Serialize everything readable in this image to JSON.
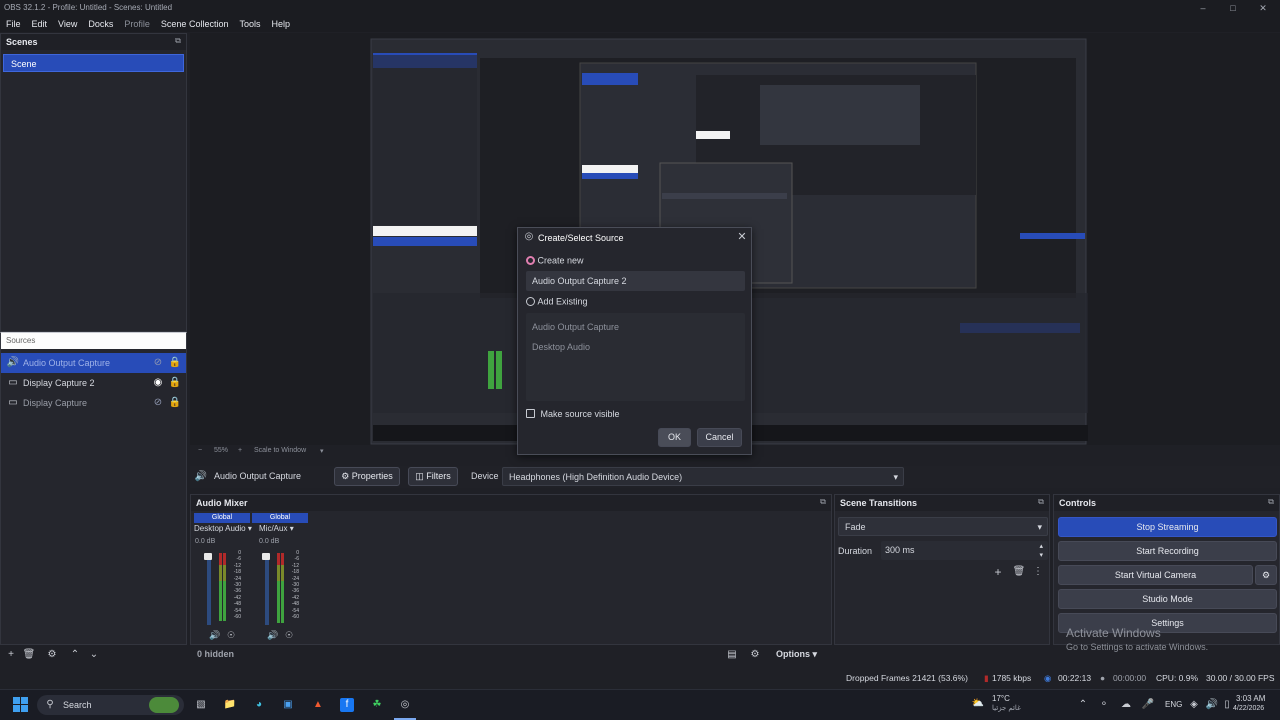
{
  "window": {
    "title": "OBS 32.1.2 - Profile: Untitled - Scenes: Untitled",
    "minimize_icon": "minimize-icon",
    "maximize_icon": "maximize-icon",
    "close_icon": "close-icon"
  },
  "menu": {
    "items": [
      "File",
      "Edit",
      "View",
      "Docks",
      "Profile",
      "Scene Collection",
      "Tools",
      "Help"
    ],
    "dimmed": [
      "Profile"
    ]
  },
  "scenes": {
    "title": "Scenes",
    "items": [
      {
        "label": "Scene",
        "selected": true
      }
    ]
  },
  "sources": {
    "title": "Sources",
    "items": [
      {
        "label": "Audio Output Capture",
        "icon": "speaker-icon",
        "visible": false,
        "selected": true
      },
      {
        "label": "Display Capture 2",
        "icon": "monitor-icon",
        "visible": true,
        "selected": false
      },
      {
        "label": "Display Capture",
        "icon": "monitor-icon",
        "visible": false,
        "selected": false
      }
    ]
  },
  "preview": {
    "zoom": "55%",
    "scale_mode": "Scale to Window"
  },
  "context_bar": {
    "source_name": "Audio Output Capture",
    "properties_label": "Properties",
    "filters_label": "Filters",
    "device_label": "Device",
    "device_value": "Headphones (High Definition Audio Device)"
  },
  "audio_mixer": {
    "title": "Audio Mixer",
    "channels": [
      {
        "tag": "Global",
        "name": "Desktop Audio",
        "level": "0.0 dB"
      },
      {
        "tag": "Global",
        "name": "Mic/Aux",
        "level": "0.0 dB"
      }
    ],
    "scale": [
      "0",
      "-6",
      "-12",
      "-18",
      "-24",
      "-30",
      "-36",
      "-42",
      "-48",
      "-54",
      "-60"
    ],
    "hidden_label": "0 hidden",
    "options_label": "Options"
  },
  "transitions": {
    "title": "Scene Transitions",
    "selected": "Fade",
    "duration_label": "Duration",
    "duration_value": "300 ms"
  },
  "controls": {
    "title": "Controls",
    "stop_streaming": "Stop Streaming",
    "start_recording": "Start Recording",
    "start_virtual_camera": "Start Virtual Camera",
    "studio_mode": "Studio Mode",
    "settings": "Settings"
  },
  "activate": {
    "title": "Activate Windows",
    "subtitle": "Go to Settings to activate Windows."
  },
  "status": {
    "dropped_frames": "Dropped Frames 21421 (53.6%)",
    "bitrate": "1785 kbps",
    "stream_time": "00:22:13",
    "record_time": "00:00:00",
    "cpu": "CPU: 0.9%",
    "fps": "30.00 / 30.00 FPS"
  },
  "dialog": {
    "title": "Create/Select Source",
    "create_new_label": "Create new",
    "name_value": "Audio Output Capture 2",
    "add_existing_label": "Add Existing",
    "existing_items": [
      "Audio Output Capture",
      "Desktop Audio"
    ],
    "make_visible_label": "Make source visible",
    "ok_label": "OK",
    "cancel_label": "Cancel"
  },
  "taskbar": {
    "search_label": "Search",
    "weather_temp": "17°C",
    "weather_desc": "غائم جزئيا",
    "lang": "ENG",
    "time": "3:03 AM",
    "date": "4/22/2026"
  },
  "colors": {
    "accent": "#284cb8",
    "dock_bg": "#25262d",
    "app_bg": "#1f2026",
    "meter_green": "#3fa33f",
    "meter_red": "#b12a2a"
  }
}
